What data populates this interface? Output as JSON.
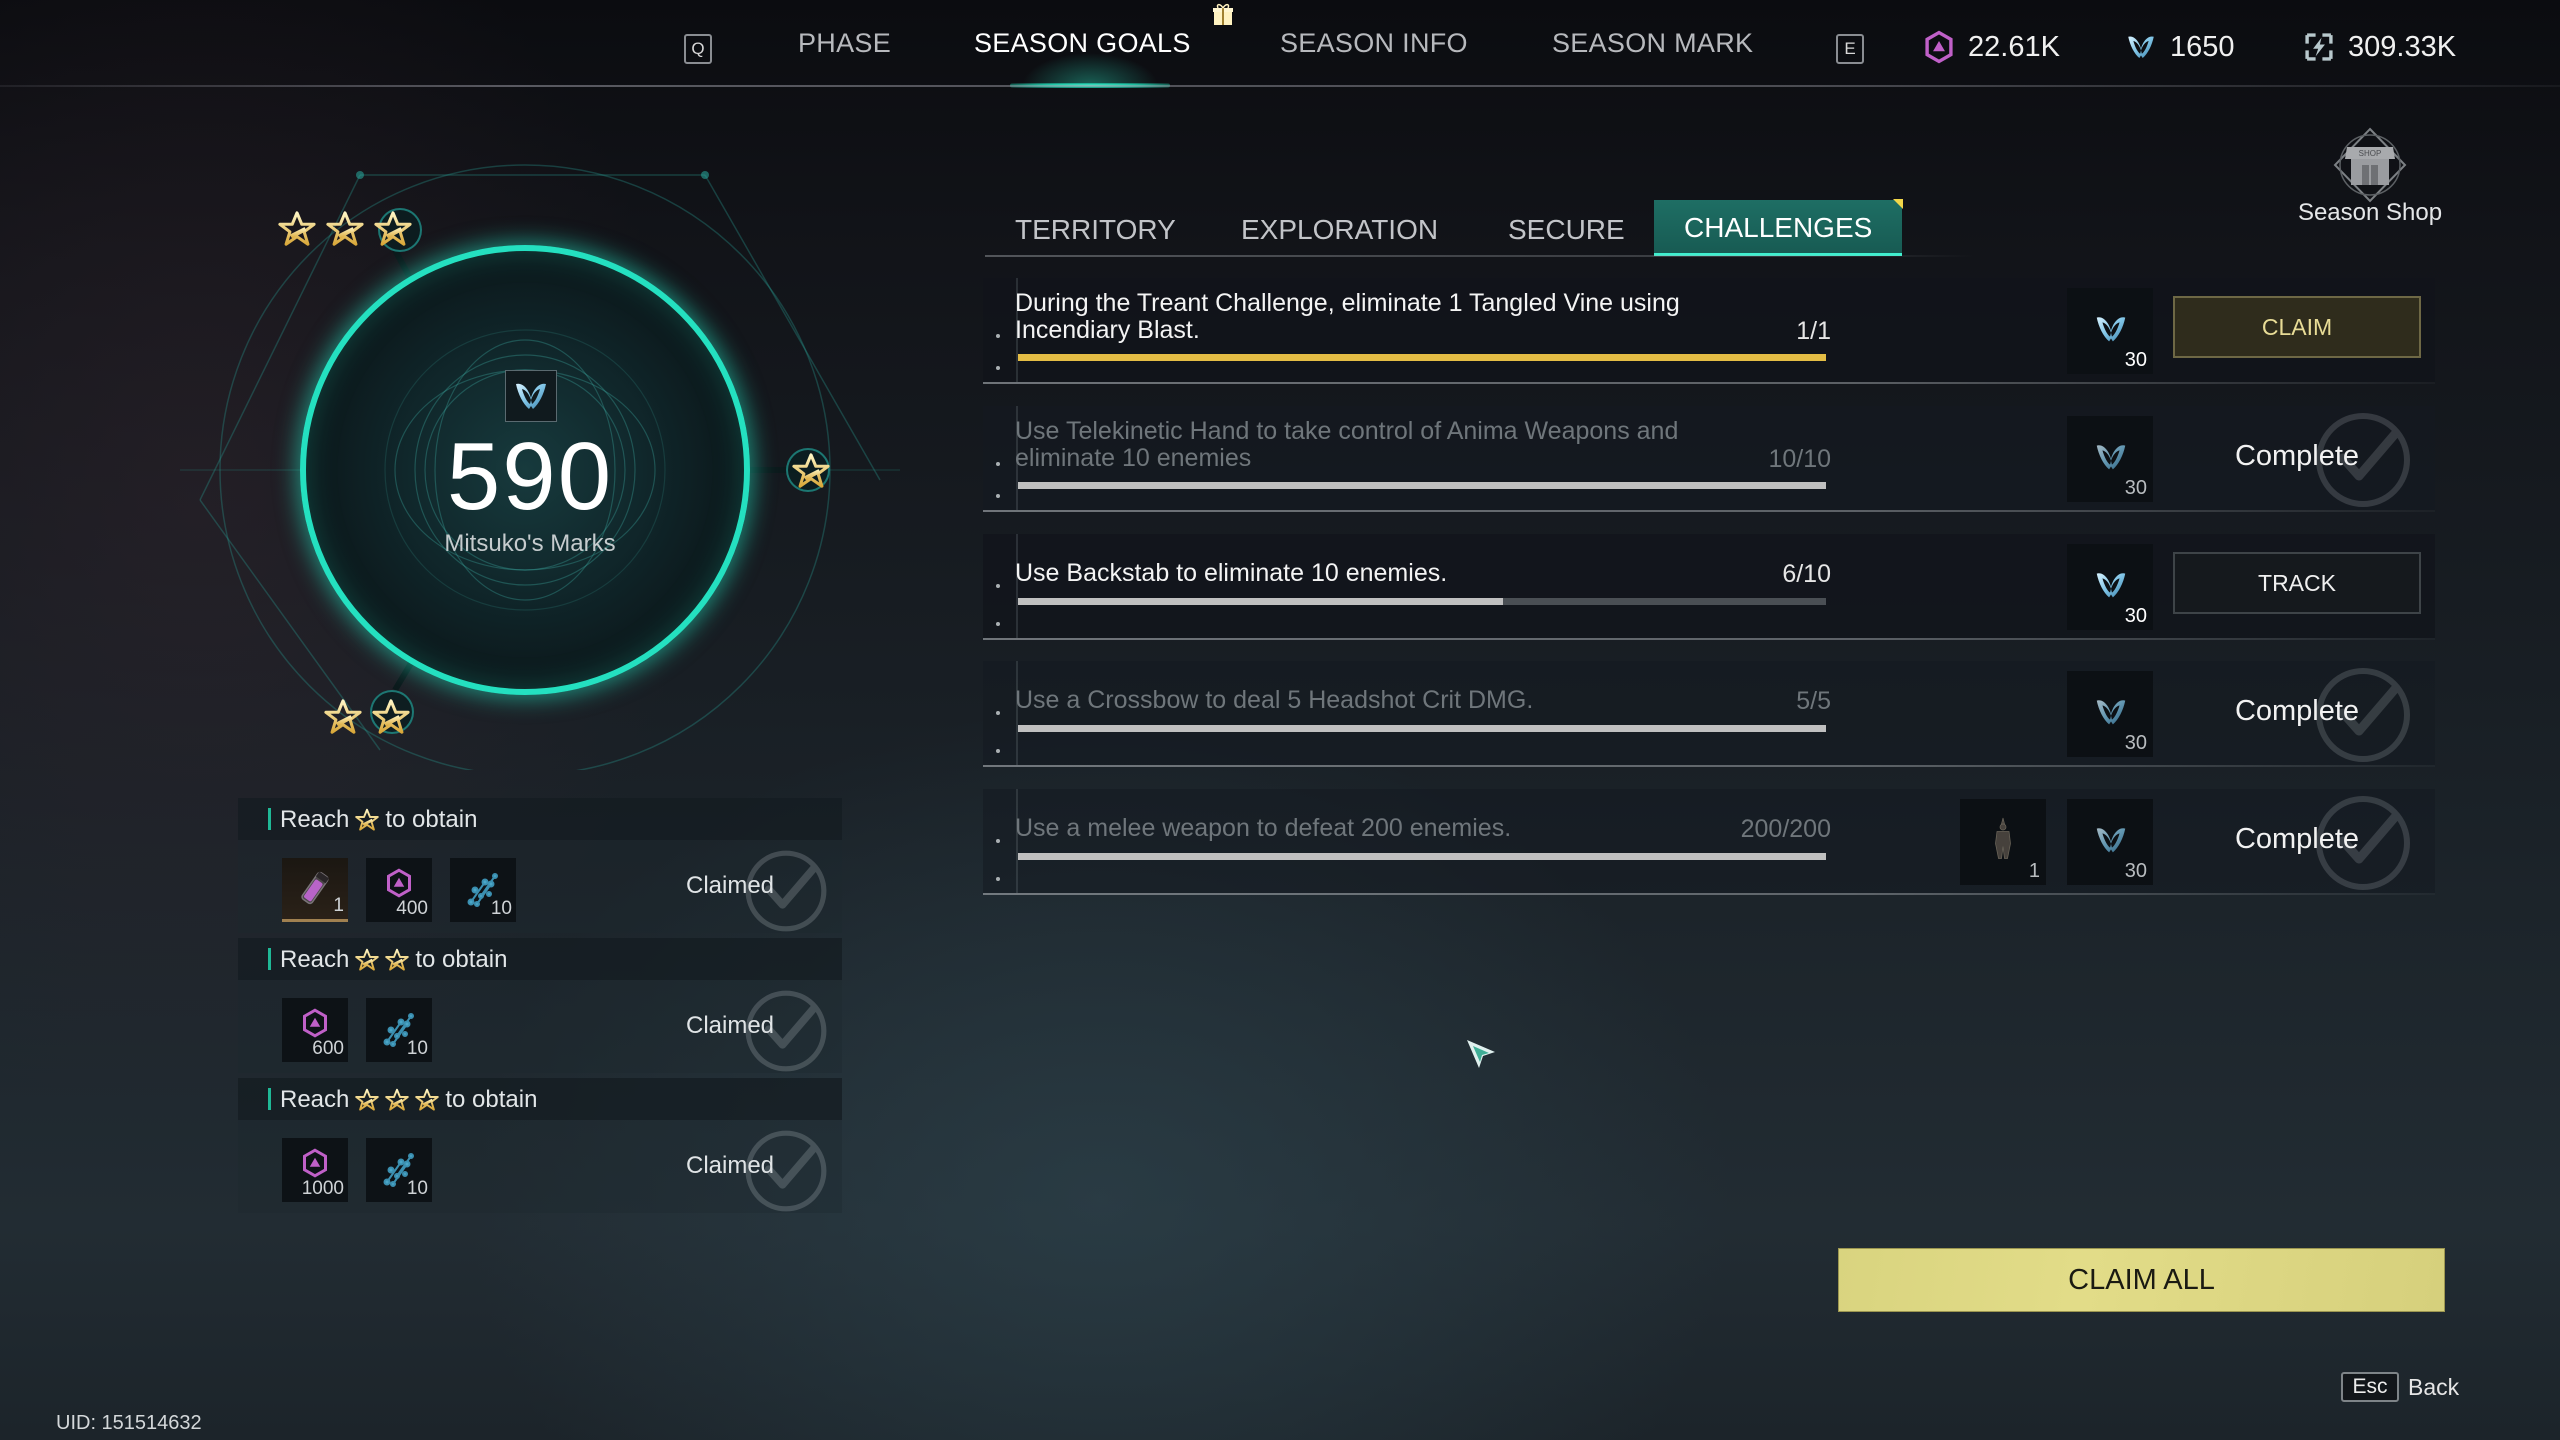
{
  "top_nav": {
    "left_key": "Q",
    "right_key": "E",
    "tabs": [
      {
        "label": "PHASE",
        "active": false
      },
      {
        "label": "SEASON GOALS",
        "active": true
      },
      {
        "label": "SEASON INFO",
        "active": false
      },
      {
        "label": "SEASON MARK",
        "active": false
      }
    ],
    "currencies": [
      {
        "icon": "hexagon-crystal-icon",
        "value": "22.61K",
        "color": "#c060c8"
      },
      {
        "icon": "mitsuko-mark-icon",
        "value": "1650",
        "color": "#8fd0ea"
      },
      {
        "icon": "energy-bolt-icon",
        "value": "309.33K",
        "color": "#b8c8cc"
      }
    ]
  },
  "marks": {
    "value": "590",
    "label": "Mitsuko's Marks",
    "accent_color": "#24e0c0",
    "star_tiers_reached": 3
  },
  "reward_tiers": [
    {
      "title_prefix": "Reach",
      "title_suffix": "to obtain",
      "stars": 1,
      "status": "Claimed",
      "rewards": [
        {
          "icon": "vial-icon",
          "qty": "1"
        },
        {
          "icon": "hexagon-crystal-icon",
          "qty": "400"
        },
        {
          "icon": "dna-strand-icon",
          "qty": "10"
        }
      ]
    },
    {
      "title_prefix": "Reach",
      "title_suffix": "to obtain",
      "stars": 2,
      "status": "Claimed",
      "rewards": [
        {
          "icon": "hexagon-crystal-icon",
          "qty": "600"
        },
        {
          "icon": "dna-strand-icon",
          "qty": "10"
        }
      ]
    },
    {
      "title_prefix": "Reach",
      "title_suffix": "to obtain",
      "stars": 3,
      "status": "Claimed",
      "rewards": [
        {
          "icon": "hexagon-crystal-icon",
          "qty": "1000"
        },
        {
          "icon": "dna-strand-icon",
          "qty": "10"
        }
      ]
    }
  ],
  "sub_tabs": [
    {
      "label": "TERRITORY",
      "active": false
    },
    {
      "label": "EXPLORATION",
      "active": false
    },
    {
      "label": "SECURE",
      "active": false
    },
    {
      "label": "CHALLENGES",
      "active": true,
      "notification": true
    }
  ],
  "season_shop": {
    "label": "Season Shop",
    "icon_text": "SHOP"
  },
  "challenges": [
    {
      "text": "During the Treant Challenge, eliminate 1 Tangled Vine using Incendiary Blast.",
      "progress_label": "1/1",
      "progress": 1.0,
      "state": "claimable",
      "rewards": [
        {
          "icon": "mitsuko-mark-icon",
          "qty": "30"
        }
      ],
      "action_label": "CLAIM"
    },
    {
      "text": "Use Telekinetic Hand to take control of Anima Weapons and eliminate 10 enemies",
      "progress_label": "10/10",
      "progress": 1.0,
      "state": "complete",
      "rewards": [
        {
          "icon": "mitsuko-mark-icon",
          "qty": "30"
        }
      ],
      "action_label": "Complete"
    },
    {
      "text": "Use Backstab to eliminate 10 enemies.",
      "progress_label": "6/10",
      "progress": 0.6,
      "state": "in_progress",
      "rewards": [
        {
          "icon": "mitsuko-mark-icon",
          "qty": "30"
        }
      ],
      "action_label": "TRACK"
    },
    {
      "text": "Use a Crossbow to deal 5 Headshot Crit DMG.",
      "progress_label": "5/5",
      "progress": 1.0,
      "state": "complete",
      "rewards": [
        {
          "icon": "mitsuko-mark-icon",
          "qty": "30"
        }
      ],
      "action_label": "Complete"
    },
    {
      "text": "Use a melee weapon to defeat 200 enemies.",
      "progress_label": "200/200",
      "progress": 1.0,
      "state": "complete",
      "rewards": [
        {
          "icon": "armor-outfit-icon",
          "qty": "1"
        },
        {
          "icon": "mitsuko-mark-icon",
          "qty": "30"
        }
      ],
      "action_label": "Complete"
    }
  ],
  "footer": {
    "claim_all_label": "CLAIM ALL",
    "back_key": "Esc",
    "back_label": "Back",
    "uid": "UID: 151514632"
  },
  "colors": {
    "teal_accent": "#24e0c0",
    "gold_progress": "#e4bd45",
    "claim_all_bg": "#ddd783",
    "claim_button_text": "#e8dc96"
  }
}
